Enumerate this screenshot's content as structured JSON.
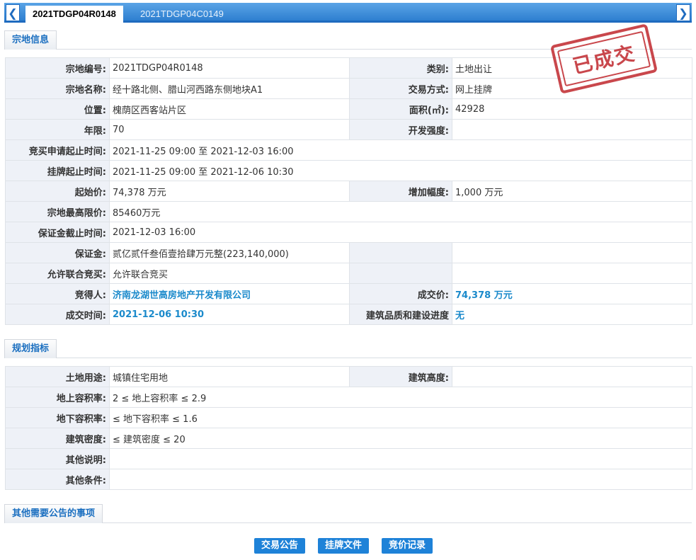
{
  "tabs": {
    "active": "2021TDGP04R0148",
    "inactive": "2021TDGP04C0149",
    "prev_icon": "chevron-left-icon",
    "next_icon": "chevron-right-icon"
  },
  "stamp": "已成交",
  "sections": {
    "parcel_info": "宗地信息",
    "planning": "规划指标",
    "other": "其他需要公告的事项"
  },
  "parcel": {
    "code_label": "宗地编号:",
    "code": "2021TDGP04R0148",
    "category_label": "类别:",
    "category": "土地出让",
    "name_label": "宗地名称:",
    "name": "经十路北侧、腊山河西路东侧地块A1",
    "method_label": "交易方式:",
    "method": "网上挂牌",
    "location_label": "位置:",
    "location": "槐荫区西客站片区",
    "area_label": "面积(㎡):",
    "area": "42928",
    "term_label": "年限:",
    "term": "70",
    "intensity_label": "开发强度:",
    "intensity": "",
    "apply_time_label": "竞买申请起止时间:",
    "apply_time": "2021-11-25 09:00 至 2021-12-03 16:00",
    "listing_time_label": "挂牌起止时间:",
    "listing_time": "2021-11-25 09:00 至 2021-12-06 10:30",
    "start_price_label": "起始价:",
    "start_price": "74,378 万元",
    "increment_label": "增加幅度:",
    "increment": "1,000 万元",
    "max_price_label": "宗地最高限价:",
    "max_price": "85460万元",
    "deposit_deadline_label": "保证金截止时间:",
    "deposit_deadline": "2021-12-03 16:00",
    "deposit_label": "保证金:",
    "deposit": "贰亿贰仟叁佰壹拾肆万元整(223,140,000)",
    "joint_label": "允许联合竞买:",
    "joint": "允许联合竞买",
    "winner_label": "竞得人:",
    "winner": "济南龙湖世高房地产开发有限公司",
    "deal_price_label": "成交价:",
    "deal_price": "74,378 万元",
    "deal_time_label": "成交时间:",
    "deal_time": "2021-12-06 10:30",
    "quality_label": "建筑品质和建设进度",
    "quality": "无"
  },
  "planning": {
    "use_label": "土地用途:",
    "use": "城镇住宅用地",
    "height_label": "建筑高度:",
    "height": "",
    "far_above_label": "地上容积率:",
    "far_above": "2 ≤ 地上容积率 ≤ 2.9",
    "far_below_label": "地下容积率:",
    "far_below": "≤ 地下容积率 ≤ 1.6",
    "density_label": "建筑密度:",
    "density": "≤ 建筑密度 ≤ 20",
    "notes_label": "其他说明:",
    "notes": "",
    "conditions_label": "其他条件:",
    "conditions": ""
  },
  "buttons": {
    "announcement": "交易公告",
    "listing_docs": "挂牌文件",
    "bid_records": "竞价记录"
  }
}
